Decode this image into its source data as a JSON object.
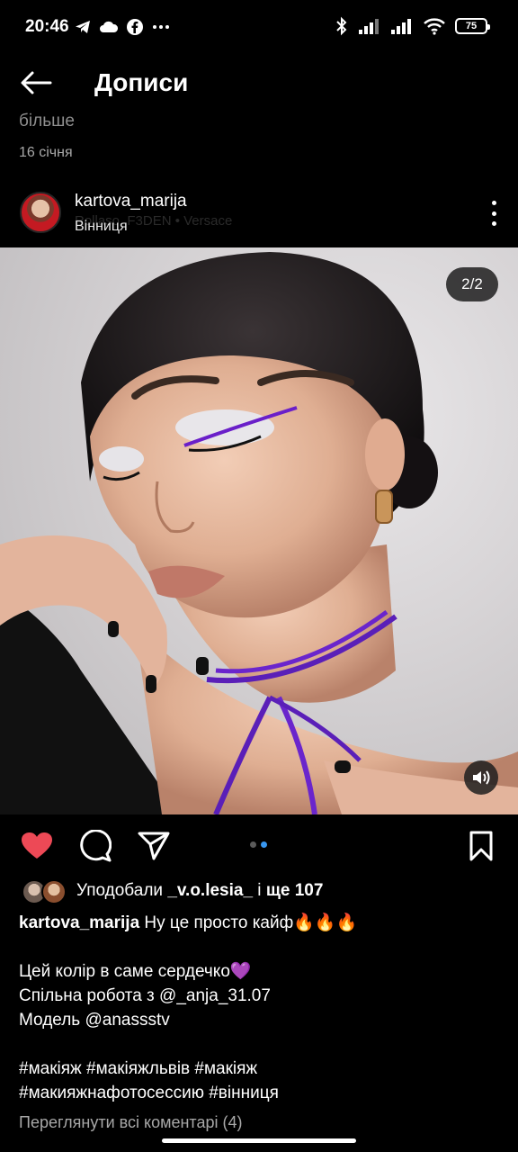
{
  "status_bar": {
    "time": "20:46",
    "left_icons": [
      "telegram-icon",
      "cloud-icon",
      "facebook-icon",
      "more-dots-icon"
    ],
    "right_icons": [
      "bluetooth-icon",
      "signal-icon",
      "signal-icon",
      "wifi-icon"
    ],
    "battery": "75"
  },
  "header": {
    "title": "Дописи"
  },
  "previous_post": {
    "more_text": "більше",
    "date": "16 січня"
  },
  "post": {
    "username": "kartova_marija",
    "location": "Вінниця",
    "music": "Rollaso, F3DEN • Versace",
    "page_counter": "2/2",
    "carousel_total": 2,
    "carousel_active": 2,
    "liked": true,
    "likes": {
      "prefix": "Уподобали ",
      "user": "_v.o.lesia_",
      "middle": " і ",
      "count": "ще 107"
    },
    "caption": {
      "user": "kartova_marija",
      "lines": [
        " Ну це просто кайф🔥🔥🔥",
        "",
        "Цей колір в саме сердечко💜",
        "Спільна робота з @_anja_31.07",
        "Модель @anassstv",
        "",
        "#макіяж #макіяжльвів #макіяж",
        "#макияжнафотосессию #вінниця"
      ]
    },
    "view_comments": "Переглянути всі коментарі (4)"
  },
  "colors": {
    "background": "#000000",
    "like_red": "#ed4956",
    "accent_blue": "#3897f0",
    "muted_text": "#a8a8a8"
  }
}
